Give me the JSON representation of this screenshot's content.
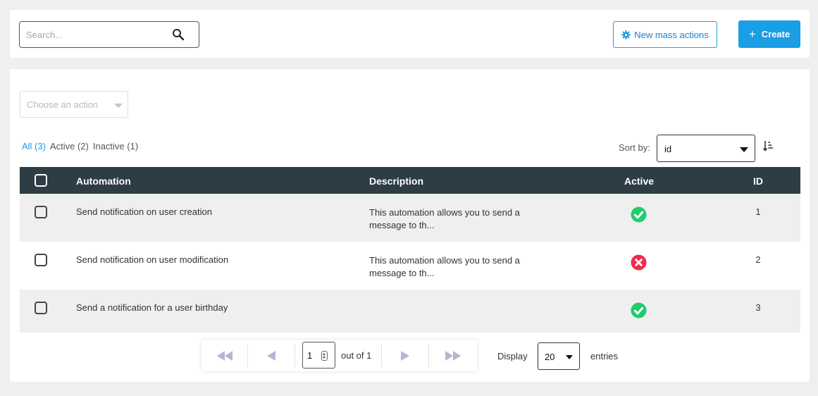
{
  "search": {
    "placeholder": "Search..."
  },
  "toolbar": {
    "mass_actions_label": "New mass actions",
    "create_label": "Create"
  },
  "bulk_action": {
    "placeholder": "Choose an action"
  },
  "filters": [
    {
      "label": "All (3)",
      "active": true
    },
    {
      "label": "Active (2)",
      "active": false
    },
    {
      "label": "Inactive (1)",
      "active": false
    }
  ],
  "sort": {
    "label": "Sort by:",
    "value": "id"
  },
  "table": {
    "columns": {
      "automation": "Automation",
      "description": "Description",
      "active": "Active",
      "id": "ID"
    },
    "rows": [
      {
        "automation": "Send notification on user creation",
        "description": "This automation allows you to send a message to th...",
        "active": true,
        "id": "1"
      },
      {
        "automation": "Send notification on user modification",
        "description": "This automation allows you to send a message to th...",
        "active": false,
        "id": "2"
      },
      {
        "automation": "Send a notification for a user birthday",
        "description": "",
        "active": true,
        "id": "3"
      }
    ]
  },
  "pagination": {
    "page": "1",
    "out_of": "out of 1"
  },
  "display": {
    "label": "Display",
    "value": "20",
    "suffix": "entries"
  },
  "colors": {
    "accent": "#1a9ee6",
    "header_bg": "#2d3d45",
    "active_green": "#22cc6e",
    "inactive_red": "#ef2d4c",
    "pager_icon": "#b6b6d4"
  },
  "icons": {
    "search": "search-icon",
    "gear": "gear-icon",
    "plus": "plus-icon",
    "sort": "sort-ascending-icon",
    "check": "check-circle-icon",
    "cross": "x-circle-icon"
  }
}
